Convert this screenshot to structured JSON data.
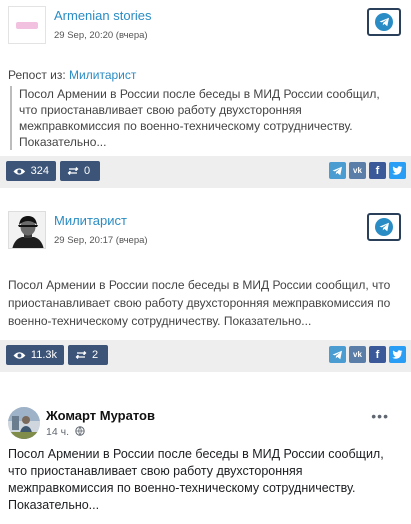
{
  "post1": {
    "channel": "Armenian stories",
    "time": "29 Sep, 20:20 (вчера)",
    "repost_prefix": "Репост из:",
    "repost_source": "Милитарист",
    "text": "Посол Армении в России после беседы в МИД России сообщил, что приостанавливает свою работу двухсторонняя межправкомиссия по военно-техническому сотрудничеству. Показательно...",
    "views": "324",
    "reposts": "0"
  },
  "post2": {
    "channel": "Милитарист",
    "time": "29 Sep, 20:17 (вчера)",
    "text": "Посол Армении в России после беседы в МИД России сообщил, что приостанавливает свою работу двухсторонняя межправкомиссия по военно-техническому сотрудничеству. Показательно...",
    "views": "11.3k",
    "reposts": "2"
  },
  "post3": {
    "author": "Жомарт Муратов",
    "time": "14 ч.",
    "more": "•••",
    "text": "Посол Армении в России после беседы в МИД России сообщил, что приостанавливает свою работу двухсторонняя межправкомиссия по военно-техническому сотрудничеству. Показательно..."
  },
  "share": {
    "vk": "vk",
    "fb": "f"
  },
  "icons": {
    "telegram": "telegram-icon",
    "eye": "eye-icon",
    "repost": "repost-icon",
    "vk": "vk-icon",
    "facebook": "facebook-icon",
    "twitter": "twitter-icon",
    "globe": "globe-icon"
  },
  "colors": {
    "link": "#2a8cc4",
    "stat_bg": "#3b5478",
    "footer_bg": "#eeeeee",
    "telegram": "#4b9cd1",
    "vk": "#5a7ea8",
    "facebook": "#3b5998",
    "twitter": "#2a9df4"
  }
}
